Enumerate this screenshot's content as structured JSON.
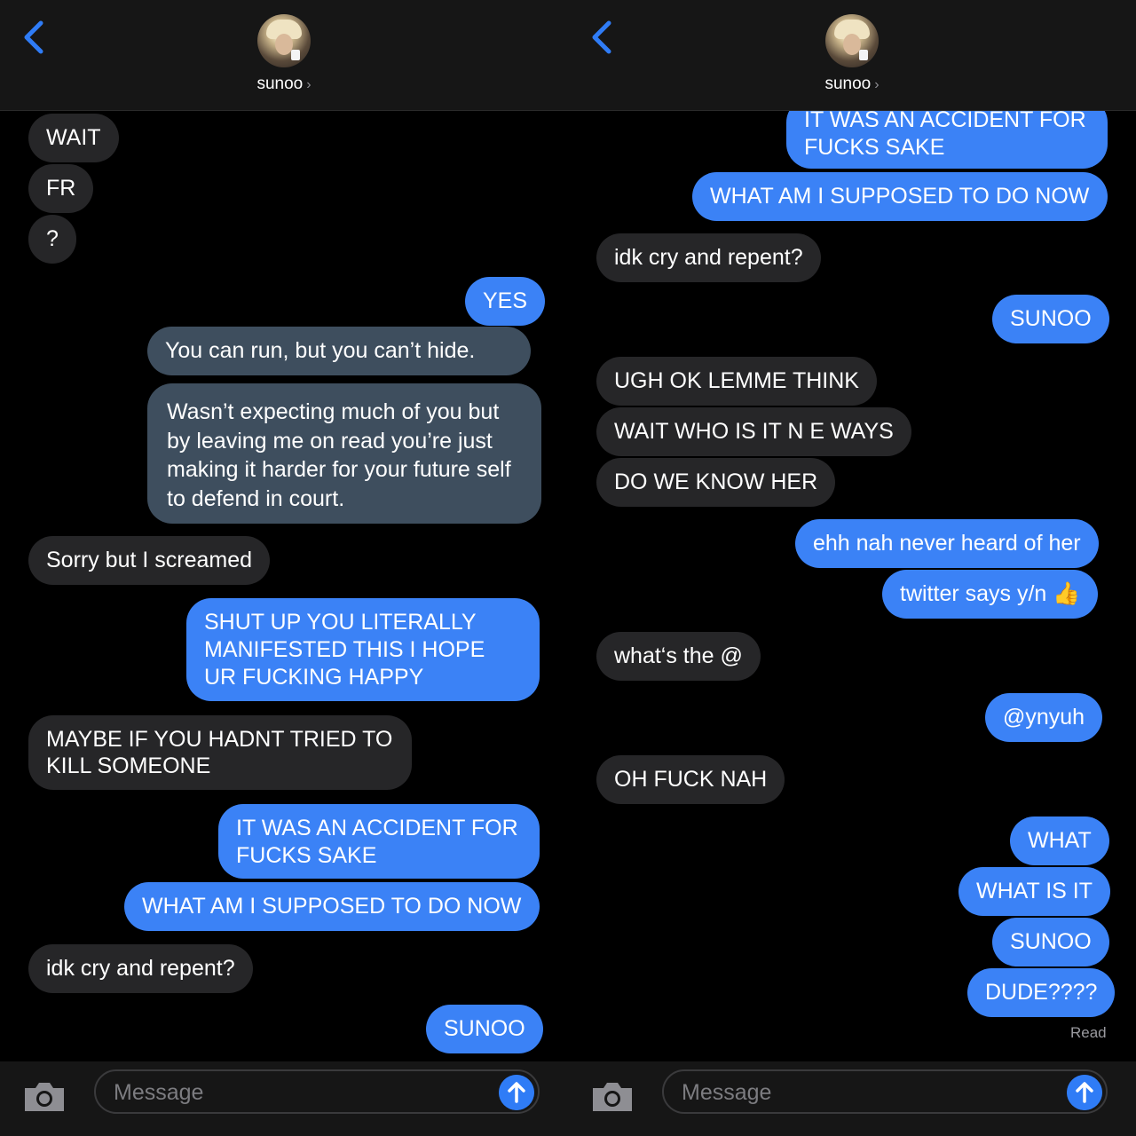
{
  "contact": {
    "name": "sunoo",
    "chevron": "›"
  },
  "composer": {
    "placeholder": "Message"
  },
  "icons": {
    "back": "chevron-left-icon",
    "camera": "camera-icon",
    "send": "arrow-up-icon"
  },
  "colors": {
    "outgoing": "#3b82f6",
    "incoming": "#262628",
    "quote": "#3e4e5e",
    "link": "#2f7cf6"
  },
  "left": {
    "m1": "WAIT",
    "m2": "FR",
    "m3": "?",
    "m4": "YES",
    "q1": "You can run, but you can’t hide.",
    "q2": "Wasn’t expecting much of you but by leaving me on read you’re just making it harder for your future self to defend in court.",
    "m5": "Sorry but I screamed",
    "m6": "SHUT UP YOU LITERALLY MANIFESTED THIS I HOPE UR FUCKING HAPPY",
    "m7": "MAYBE IF YOU HADNT TRIED TO KILL SOMEONE",
    "m8": "IT WAS AN ACCIDENT FOR FUCKS SAKE",
    "m9": "WHAT AM I SUPPOSED TO DO NOW",
    "m10": "idk cry and repent?",
    "m11": "SUNOO"
  },
  "right": {
    "m1": "IT WAS AN ACCIDENT FOR FUCKS SAKE",
    "m2": "WHAT AM I SUPPOSED TO DO NOW",
    "m3": "idk cry and repent?",
    "m4": "SUNOO",
    "m5": "UGH OK LEMME THINK",
    "m6": "WAIT WHO IS IT N E WAYS",
    "m7": "DO WE KNOW HER",
    "m8": "ehh nah never heard of her",
    "m9": "twitter says y/n",
    "m9_emoji": "👍",
    "m10": "what‘s the @",
    "m11": "@ynyuh",
    "m12": "OH FUCK NAH",
    "m13": "WHAT",
    "m14": "WHAT IS IT",
    "m15": "SUNOO",
    "m16": "DUDE????",
    "read": "Read"
  }
}
